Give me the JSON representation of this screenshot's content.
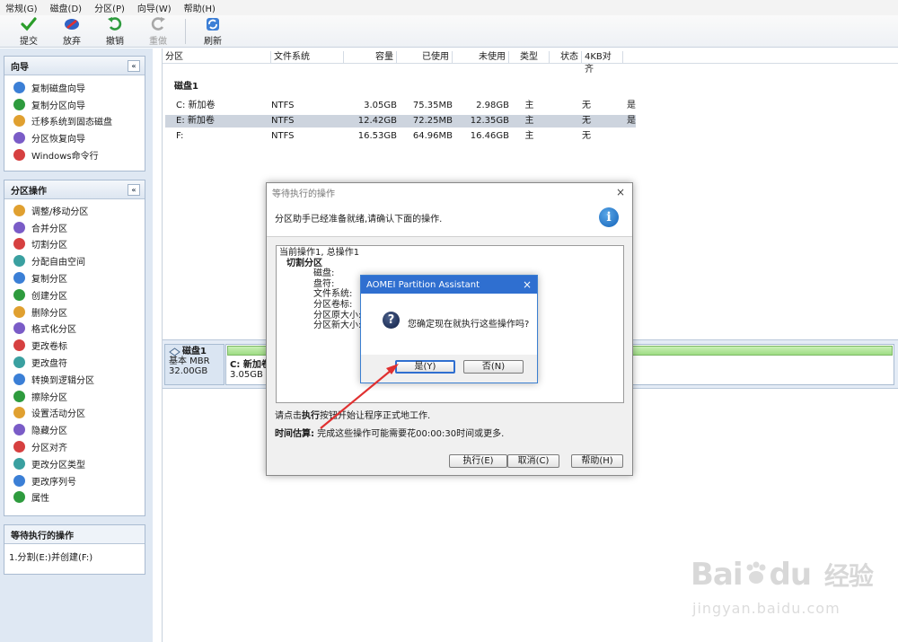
{
  "menu": [
    "常规(G)",
    "磁盘(D)",
    "分区(P)",
    "向导(W)",
    "帮助(H)"
  ],
  "toolbar": {
    "commit": "提交",
    "discard": "放弃",
    "undo": "撤销",
    "redo": "重做",
    "refresh": "刷新"
  },
  "wizard_panel": {
    "title": "向导",
    "collapse": "«",
    "items": [
      "复制磁盘向导",
      "复制分区向导",
      "迁移系统到固态磁盘",
      "分区恢复向导",
      "Windows命令行"
    ]
  },
  "partition_ops_panel": {
    "title": "分区操作",
    "collapse": "«",
    "items": [
      "调整/移动分区",
      "合并分区",
      "切割分区",
      "分配自由空间",
      "复制分区",
      "创建分区",
      "删除分区",
      "格式化分区",
      "更改卷标",
      "更改盘符",
      "转换到逻辑分区",
      "擦除分区",
      "设置活动分区",
      "隐藏分区",
      "分区对齐",
      "更改分区类型",
      "更改序列号",
      "属性"
    ]
  },
  "pending_panel": {
    "title": "等待执行的操作",
    "items": [
      "1.分割(E:)并创建(F:)"
    ]
  },
  "table": {
    "columns": [
      "分区",
      "文件系统",
      "容量",
      "已使用",
      "未使用",
      "类型",
      "状态",
      "4KB对齐"
    ],
    "disk_label": "磁盘1",
    "rows": [
      {
        "name": "C: 新加卷",
        "fs": "NTFS",
        "capacity": "3.05GB",
        "used": "75.35MB",
        "free": "2.98GB",
        "type": "主",
        "status": "无",
        "align": "是"
      },
      {
        "name": "E: 新加卷",
        "fs": "NTFS",
        "capacity": "12.42GB",
        "used": "72.25MB",
        "free": "12.35GB",
        "type": "主",
        "status": "无",
        "align": "是"
      },
      {
        "name": "F:",
        "fs": "NTFS",
        "capacity": "16.53GB",
        "used": "64.96MB",
        "free": "16.46GB",
        "type": "主",
        "status": "无",
        "align": ""
      }
    ]
  },
  "diskmap": {
    "disk_name": "磁盘1",
    "disk_type": "基本 MBR",
    "disk_size": "32.00GB",
    "part_name": "C: 新加卷",
    "part_size": "3.05GB N"
  },
  "pending_dialog": {
    "title": "等待执行的操作",
    "close": "×",
    "header": "分区助手已经准备就绪,请确认下面的操作.",
    "list": {
      "line1": "当前操作1, 总操作1",
      "line2": "切割分区",
      "fields": [
        "磁盘:",
        "盘符:",
        "文件系统:",
        "分区卷标:",
        "分区原大小:",
        "分区新大小:"
      ]
    },
    "hint_pre": "请点击",
    "hint_bold": "执行",
    "hint_post": "按钮开始让程序正式地工作.",
    "time_label": "时间估算:",
    "time_text": " 完成这些操作可能需要花00:00:30时间或更多.",
    "buttons": {
      "execute": "执行(E)",
      "cancel": "取消(C)",
      "help": "帮助(H)"
    }
  },
  "confirm_dialog": {
    "title": "AOMEI Partition Assistant",
    "close": "×",
    "message": "您确定现在就执行这些操作吗?",
    "yes": "是(Y)",
    "no": "否(N)"
  },
  "watermark": {
    "brand": "Bai",
    "brand2": "du",
    "cn": "经验",
    "url": "jingyan.baidu.com"
  },
  "colors": {
    "accent_blue": "#2f6fd0",
    "annotation_red": "#e03030",
    "disk_bar_green": "#9fdc84"
  }
}
